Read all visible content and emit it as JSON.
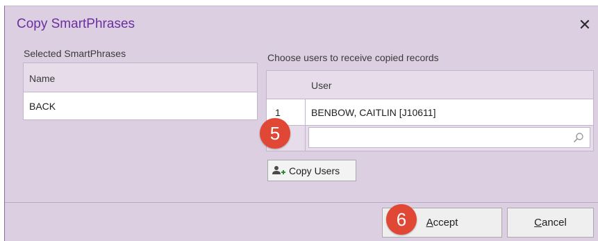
{
  "dialog": {
    "title": "Copy SmartPhrases",
    "close_icon": "close-icon"
  },
  "left_panel": {
    "label": "Selected SmartPhrases",
    "column_header": "Name",
    "rows": [
      "BACK"
    ]
  },
  "right_panel": {
    "label": "Choose users to receive copied records",
    "column_header": "User",
    "rows": [
      {
        "num": "1",
        "user": "BENBOW, CAITLIN [J10611]"
      }
    ],
    "new_row_value": "",
    "search_icon": "magnifier-icon"
  },
  "copy_users_button": {
    "label": "Copy Users",
    "icon": "add-user-icon"
  },
  "footer": {
    "accept_prefix": "",
    "accept_underlined": "A",
    "accept_rest": "ccept",
    "cancel_underlined": "C",
    "cancel_rest": "ancel"
  },
  "callouts": {
    "step5": "5",
    "step6": "6",
    "color": "#e04734"
  },
  "colors": {
    "dialog_bg": "#dccfe2",
    "title": "#6b2fa0",
    "header_bg": "#e6dcea"
  }
}
